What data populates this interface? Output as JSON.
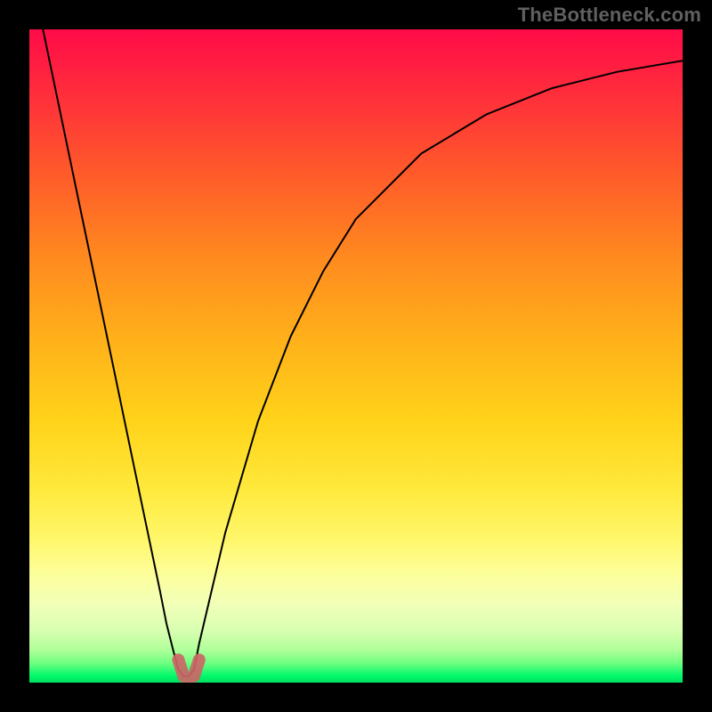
{
  "attribution": "TheBottleneck.com",
  "chart_data": {
    "type": "line",
    "title": "",
    "xlabel": "",
    "ylabel": "",
    "xlim": [
      0,
      1
    ],
    "ylim": [
      0,
      1
    ],
    "background_gradient": {
      "top": "#ff0b48",
      "mid": "#ffe83a",
      "bottom": "#00e060"
    },
    "series": [
      {
        "name": "bottleneck-curve",
        "color": "#000000",
        "x": [
          0.0,
          0.05,
          0.075,
          0.1,
          0.125,
          0.15,
          0.175,
          0.2,
          0.21,
          0.22,
          0.228,
          0.236,
          0.244,
          0.252,
          0.26,
          0.3,
          0.35,
          0.4,
          0.45,
          0.5,
          0.6,
          0.7,
          0.8,
          0.9,
          1.0
        ],
        "y": [
          1.1,
          0.86,
          0.74,
          0.62,
          0.5,
          0.38,
          0.26,
          0.14,
          0.09,
          0.05,
          0.02,
          0.01,
          0.01,
          0.02,
          0.06,
          0.23,
          0.4,
          0.53,
          0.63,
          0.71,
          0.81,
          0.87,
          0.91,
          0.935,
          0.952
        ]
      },
      {
        "name": "bottom-marker",
        "color": "#cc6666",
        "x": [
          0.228,
          0.236,
          0.244,
          0.252,
          0.26
        ],
        "y": [
          0.035,
          0.01,
          0.005,
          0.01,
          0.035
        ]
      }
    ],
    "notes": "V-shaped curve plotted over a vertical red-to-green gradient. Minimum sits near x≈0.24. Values are approximate — chart has no visible axis ticks."
  }
}
